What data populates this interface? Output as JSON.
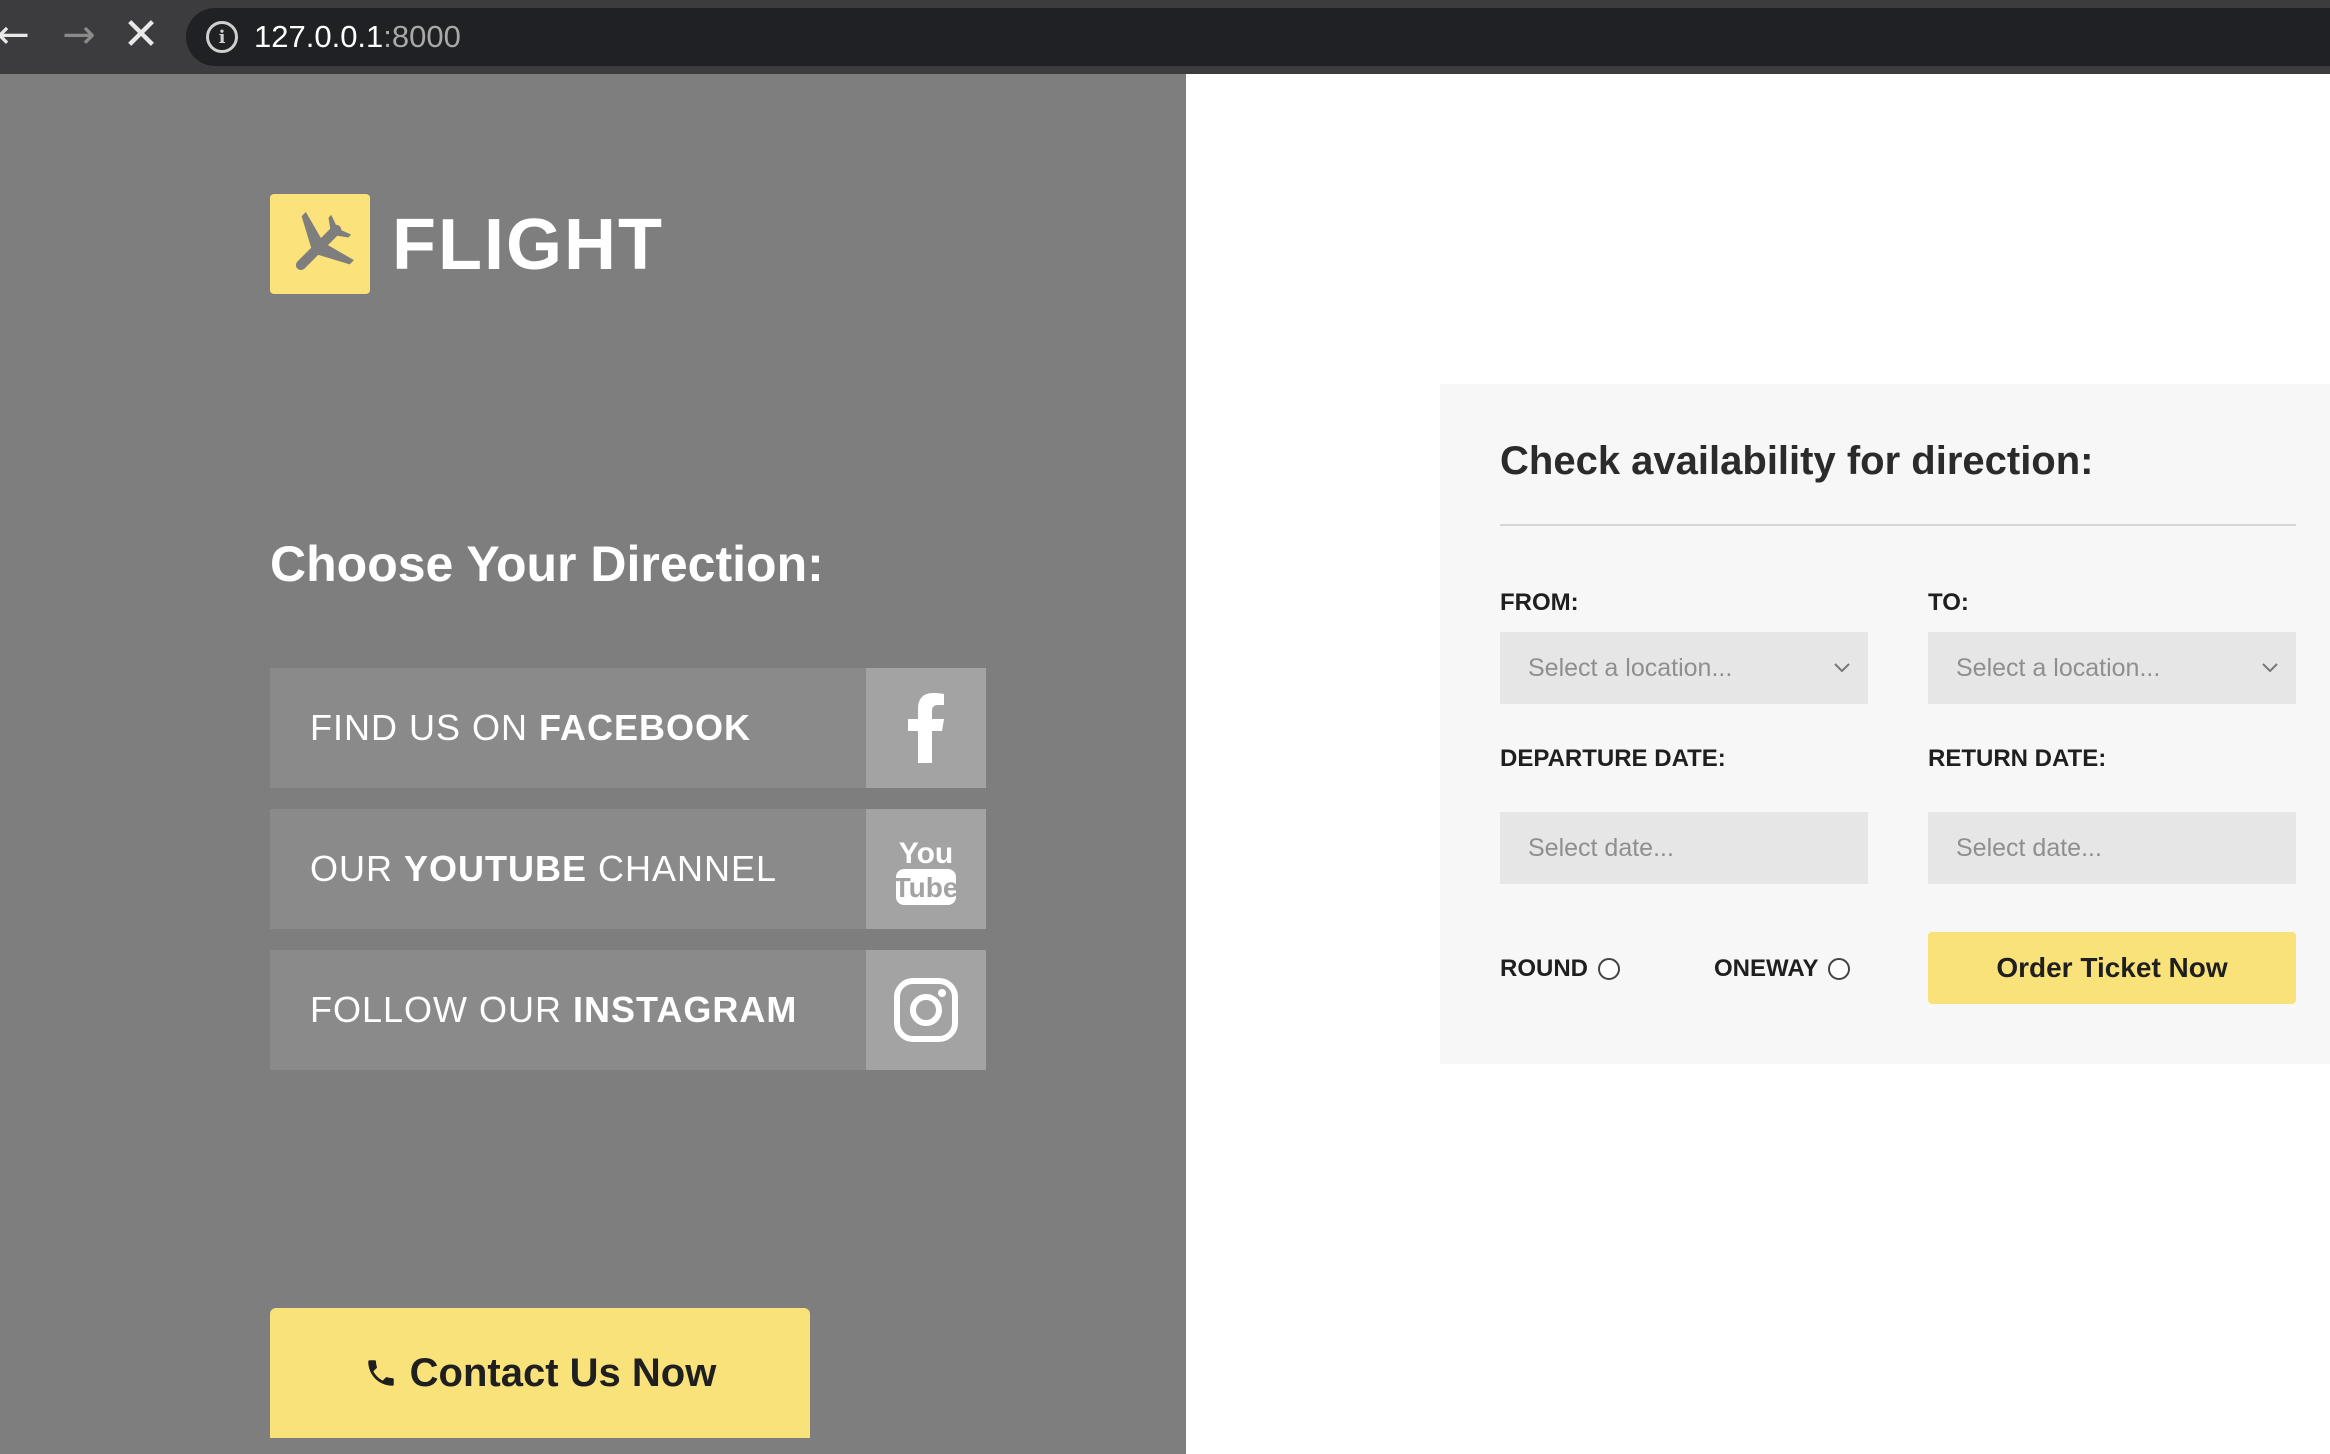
{
  "browser": {
    "url_host": "127.0.0.1",
    "url_port": ":8000"
  },
  "brand": {
    "name": "FLIGHT",
    "accent_color": "#fae27b"
  },
  "left_panel": {
    "title": "Choose Your Direction:",
    "social_links": [
      {
        "pre": "FIND US ON ",
        "bold": "FACEBOOK",
        "post": "",
        "icon": "facebook-icon"
      },
      {
        "pre": "OUR ",
        "bold": "YOUTUBE",
        "post": " CHANNEL",
        "icon": "youtube-icon"
      },
      {
        "pre": "FOLLOW OUR ",
        "bold": "INSTAGRAM",
        "post": "",
        "icon": "instagram-icon"
      }
    ],
    "youtube_icon_text": {
      "top": "You",
      "bottom": "Tube"
    },
    "contact_button": "Contact Us Now"
  },
  "form": {
    "title": "Check availability for direction:",
    "from_label": "FROM:",
    "from_placeholder": "Select a location...",
    "to_label": "TO:",
    "to_placeholder": "Select a location...",
    "departure_label": "DEPARTURE DATE:",
    "departure_placeholder": "Select date...",
    "return_label": "RETURN DATE:",
    "return_placeholder": "Select date...",
    "round_label": "ROUND",
    "oneway_label": "ONEWAY",
    "order_button": "Order Ticket Now"
  }
}
